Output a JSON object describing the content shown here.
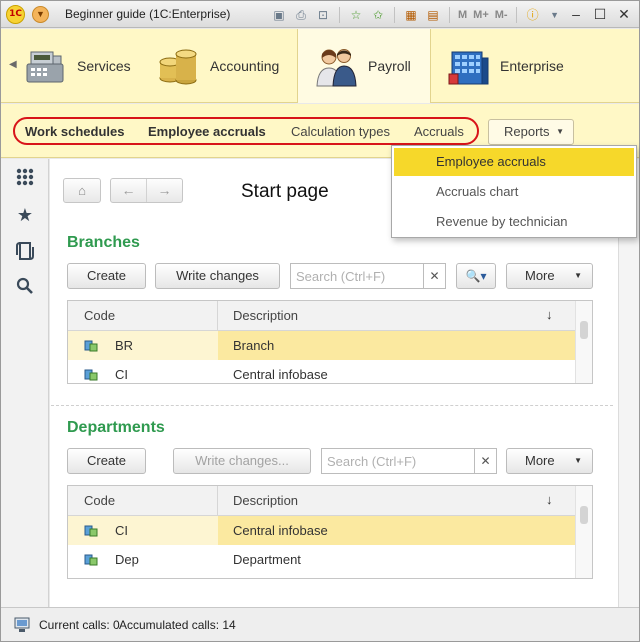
{
  "window": {
    "title": "Beginner guide  (1C:Enterprise)",
    "logo": "1C"
  },
  "toolbar": {
    "m": "M",
    "m_plus": "M+",
    "m_minus": "M-"
  },
  "sections": [
    {
      "label": "Services",
      "icon": "cash-register-icon"
    },
    {
      "label": "Accounting",
      "icon": "coins-icon"
    },
    {
      "label": "Payroll",
      "icon": "people-icon"
    },
    {
      "label": "Enterprise",
      "icon": "building-icon"
    }
  ],
  "functions": {
    "items": [
      "Work schedules",
      "Employee accruals",
      "Calculation types",
      "Accruals"
    ],
    "reports_label": "Reports"
  },
  "reports_menu": [
    "Employee accruals",
    "Accruals chart",
    "Revenue by technician"
  ],
  "page": {
    "title": "Start page"
  },
  "branches": {
    "title": "Branches",
    "create": "Create",
    "write": "Write changes",
    "search_placeholder": "Search (Ctrl+F)",
    "more": "More",
    "columns": [
      "Code",
      "Description"
    ],
    "rows": [
      {
        "code": "BR",
        "description": "Branch"
      },
      {
        "code": "CI",
        "description": "Central infobase"
      }
    ]
  },
  "departments": {
    "title": "Departments",
    "create": "Create",
    "write": "Write changes...",
    "search_placeholder": "Search (Ctrl+F)",
    "more": "More",
    "columns": [
      "Code",
      "Description"
    ],
    "rows": [
      {
        "code": "CI",
        "description": "Central infobase"
      },
      {
        "code": "Dep",
        "description": "Department"
      }
    ]
  },
  "status": {
    "current_calls": "Current calls: 0",
    "accumulated_calls": "Accumulated calls: 14"
  },
  "colors": {
    "section_bg": "#fff8c6",
    "group_title": "#2f9a4f",
    "highlight": "#f6d82a",
    "annotation": "#d8141a"
  }
}
